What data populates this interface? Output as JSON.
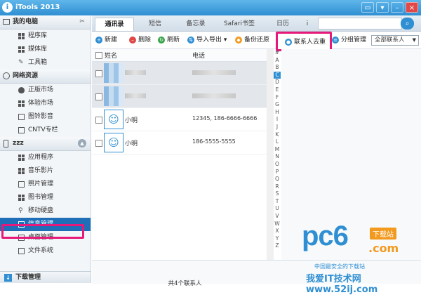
{
  "app": {
    "title": "iTools 2013",
    "logo_letter": "i"
  },
  "window_buttons": [
    "▭",
    "▾",
    "–",
    "×"
  ],
  "sidebar": {
    "sections": [
      {
        "title": "我的电脑",
        "items": [
          "程序库",
          "媒体库",
          "工具箱"
        ]
      },
      {
        "title": "网络资源",
        "items": [
          "正版市场",
          "体验市场",
          "图铃影音",
          "CNTV专栏"
        ]
      },
      {
        "title": "zzz",
        "items": [
          "应用程序",
          "音乐影片",
          "照片管理",
          "图书管理",
          "移动硬盘",
          "信息管理",
          "桌面管理",
          "文件系统"
        ]
      }
    ],
    "active_item": "信息管理",
    "bottom": "下载管理"
  },
  "tabs": [
    "通讯录",
    "短信",
    "备忘录",
    "Safari书签",
    "日历",
    "i"
  ],
  "active_tab": "通讯录",
  "search": {
    "placeholder": ""
  },
  "toolbar": {
    "new": "新建",
    "delete": "删除",
    "refresh": "刷新",
    "import_export": "导入导出",
    "backup_restore": "备份还原",
    "dedupe": "联系人去重",
    "group_manage": "分组管理",
    "group_select": "全部联系人"
  },
  "columns": {
    "name": "姓名",
    "phone": "电话"
  },
  "contacts": [
    {
      "name": "",
      "phone": "",
      "blurred": true
    },
    {
      "name": "",
      "phone": "",
      "blurred": true
    },
    {
      "name": "小明",
      "phone": "12345, 186-6666-6666",
      "blurred": false
    },
    {
      "name": "小明",
      "phone": "186-5555-5555",
      "blurred": false
    }
  ],
  "alphabet": [
    "#",
    "A",
    "B",
    "C",
    "D",
    "E",
    "F",
    "G",
    "H",
    "I",
    "J",
    "K",
    "L",
    "M",
    "N",
    "O",
    "P",
    "Q",
    "R",
    "S",
    "T",
    "U",
    "V",
    "W",
    "X",
    "Y",
    "Z"
  ],
  "alphabet_highlight": "C",
  "status": "共4个联系人",
  "watermark": {
    "brand": "pc6",
    "badge": "下载站",
    "domain": ".com",
    "slogan": "中国最安全的下载站",
    "url": "我爱IT技术网 www.52ij.com"
  },
  "colors": {
    "accent": "#2f8fd2",
    "highlight": "#e6197a",
    "selection": "#1f6fb8"
  }
}
